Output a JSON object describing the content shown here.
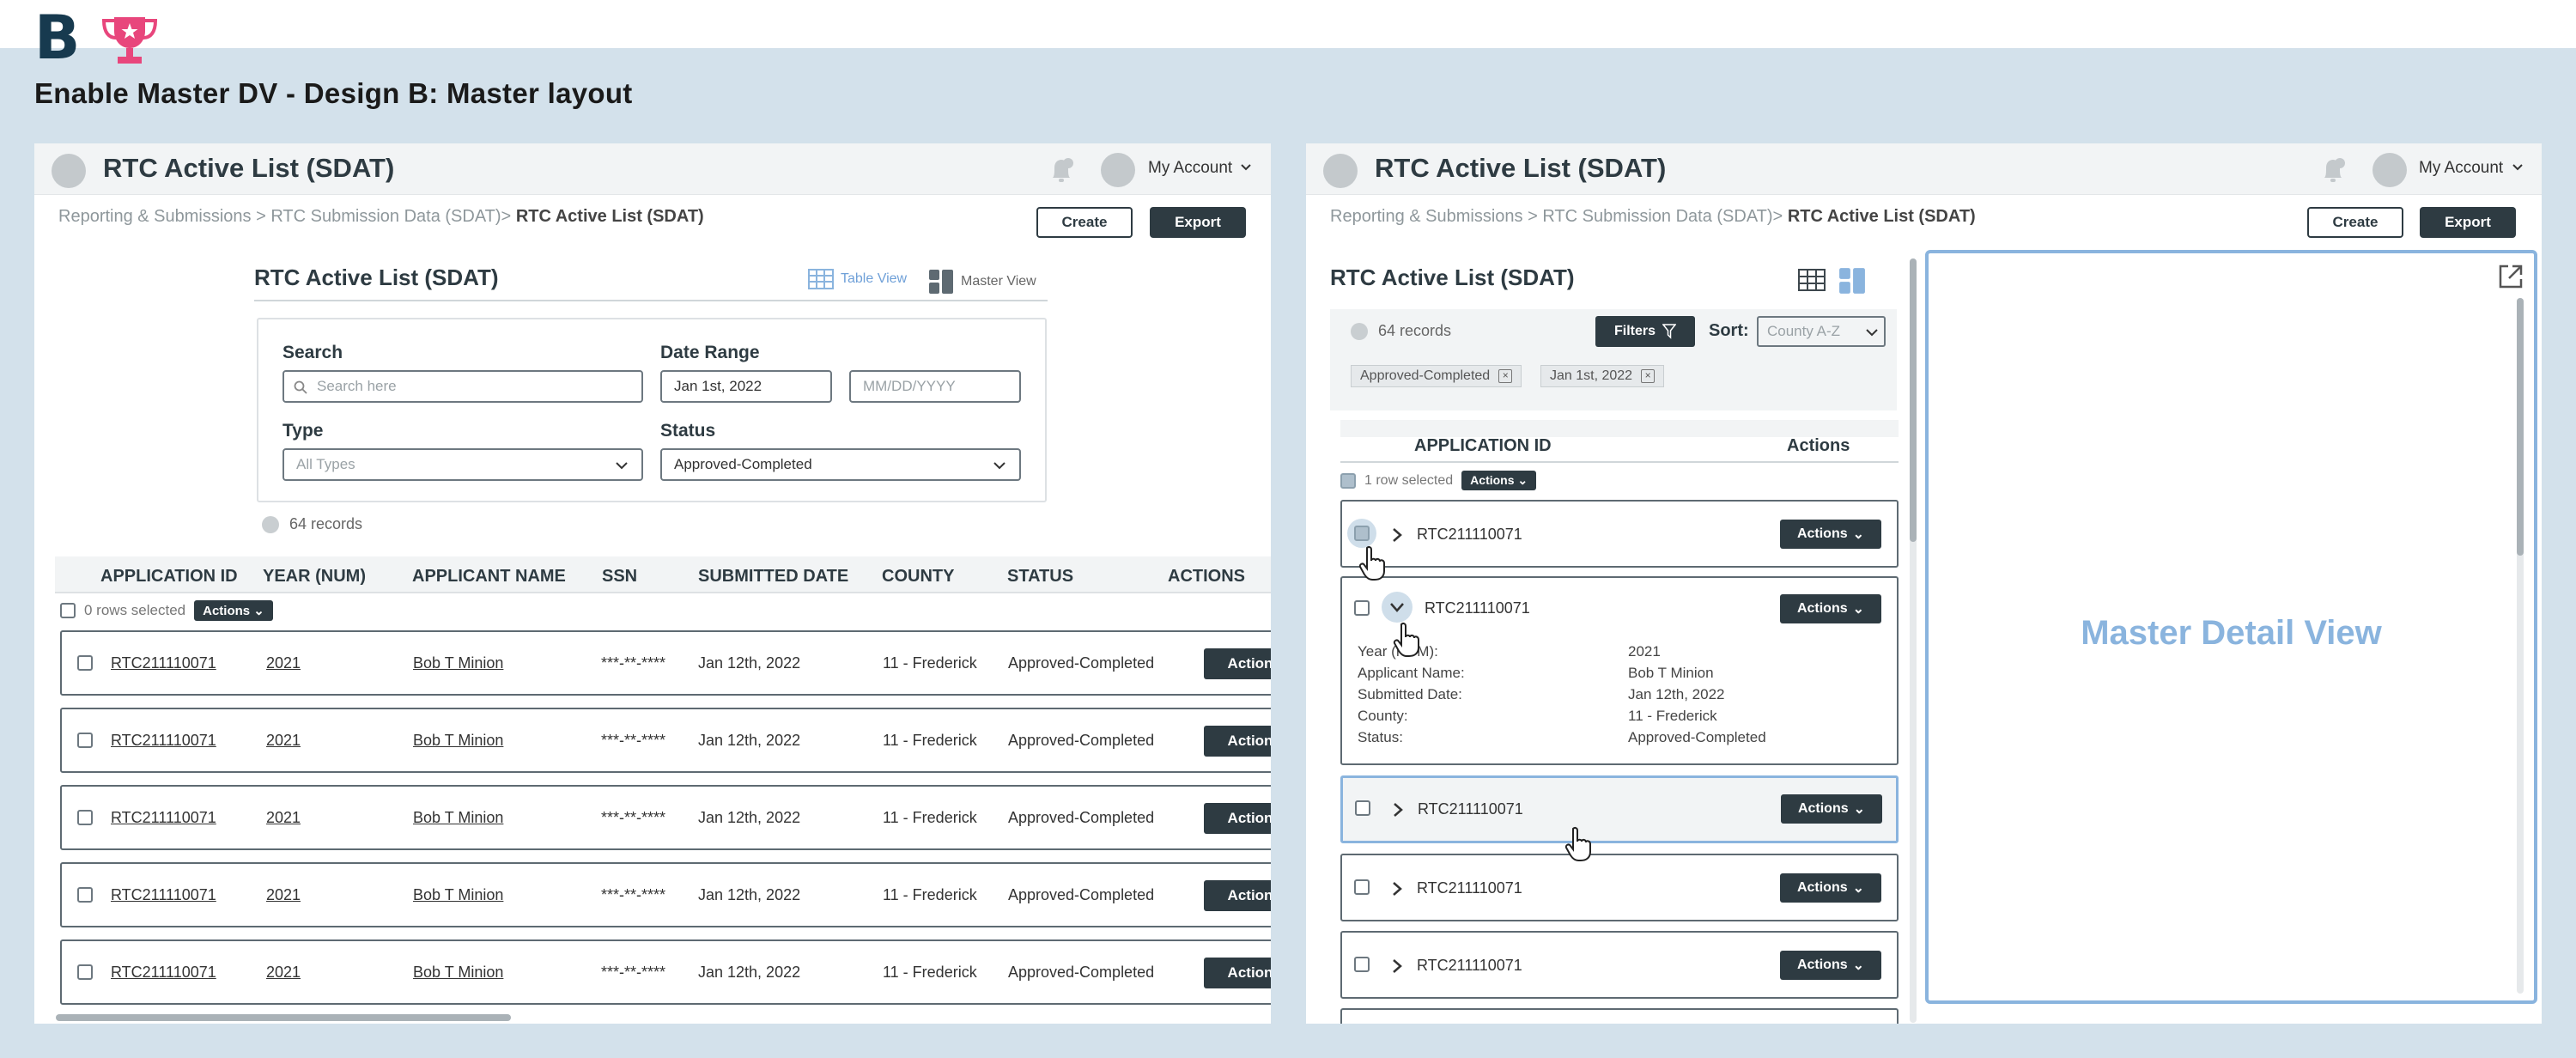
{
  "brand": {
    "letter": "B"
  },
  "page_heading": "Enable Master DV - Design B: Master layout",
  "left_panel": {
    "title": "RTC Active List (SDAT)",
    "account_label": "My Account",
    "breadcrumb": {
      "path": "Reporting & Submissions > RTC Submission Data (SDAT)>",
      "current": "RTC Active List (SDAT)"
    },
    "create_label": "Create",
    "export_label": "Export",
    "section_title": "RTC Active List (SDAT)",
    "table_view_label": "Table View",
    "master_view_label": "Master View",
    "filters": {
      "search_label": "Search",
      "search_placeholder": "Search here",
      "date_label": "Date Range",
      "date_from": "Jan 1st, 2022",
      "date_to_placeholder": "MM/DD/YYYY",
      "type_label": "Type",
      "type_value": "All Types",
      "status_label": "Status",
      "status_value": "Approved-Completed"
    },
    "records": "64 records",
    "columns": [
      "APPLICATION ID",
      "YEAR (NUM)",
      "APPLICANT NAME",
      "SSN",
      "SUBMITTED DATE",
      "COUNTY",
      "STATUS",
      "ACTIONS"
    ],
    "selected_text": "0 rows selected",
    "actions_label": "Actions",
    "rows": [
      {
        "id": "RTC211110071",
        "year": "2021",
        "name": "Bob T Minion",
        "ssn": "***-**-****",
        "date": "Jan 12th, 2022",
        "county": "11 - Frederick",
        "status": "Approved-Completed",
        "action": "Action"
      },
      {
        "id": "RTC211110071",
        "year": "2021",
        "name": "Bob T Minion",
        "ssn": "***-**-****",
        "date": "Jan 12th, 2022",
        "county": "11 - Frederick",
        "status": "Approved-Completed",
        "action": "Action"
      },
      {
        "id": "RTC211110071",
        "year": "2021",
        "name": "Bob T Minion",
        "ssn": "***-**-****",
        "date": "Jan 12th, 2022",
        "county": "11 - Frederick",
        "status": "Approved-Completed",
        "action": "Action"
      },
      {
        "id": "RTC211110071",
        "year": "2021",
        "name": "Bob T Minion",
        "ssn": "***-**-****",
        "date": "Jan 12th, 2022",
        "county": "11 - Frederick",
        "status": "Approved-Completed",
        "action": "Action"
      },
      {
        "id": "RTC211110071",
        "year": "2021",
        "name": "Bob T Minion",
        "ssn": "***-**-****",
        "date": "Jan 12th, 2022",
        "county": "11 - Frederick",
        "status": "Approved-Completed",
        "action": "Action"
      }
    ]
  },
  "right_panel": {
    "title": "RTC Active List (SDAT)",
    "account_label": "My Account",
    "breadcrumb": {
      "path": "Reporting & Submissions > RTC Submission Data (SDAT)>",
      "current": "RTC Active List (SDAT)"
    },
    "create_label": "Create",
    "export_label": "Export",
    "section_title": "RTC Active List (SDAT)",
    "records": "64 records",
    "filters_label": "Filters",
    "sort_label": "Sort:",
    "sort_value": "County A-Z",
    "chips": [
      "Approved-Completed",
      "Jan 1st, 2022"
    ],
    "col_app_id": "APPLICATION ID",
    "col_actions": "Actions",
    "selected_text": "1 row selected",
    "actions_label": "Actions",
    "cards": [
      {
        "id": "RTC211110071",
        "action": "Actions"
      },
      {
        "id": "RTC211110071",
        "action": "Actions"
      },
      {
        "id": "RTC211110071",
        "action": "Actions"
      },
      {
        "id": "RTC211110071",
        "action": "Actions"
      },
      {
        "id": "RTC211110071",
        "action": "Actions"
      }
    ],
    "detail_rows": [
      {
        "label": "Year (NUM):",
        "value": "2021"
      },
      {
        "label": "Applicant Name:",
        "value": "Bob T Minion"
      },
      {
        "label": "Submitted Date:",
        "value": "Jan 12th, 2022"
      },
      {
        "label": "County:",
        "value": "11 - Frederick"
      },
      {
        "label": "Status:",
        "value": "Approved-Completed"
      }
    ],
    "master_detail_label": "Master Detail View"
  },
  "colors": {
    "accent": "#8ab4de",
    "dark": "#2e3b42",
    "background": "#d3e1eb",
    "trophy": "#e8467c"
  }
}
